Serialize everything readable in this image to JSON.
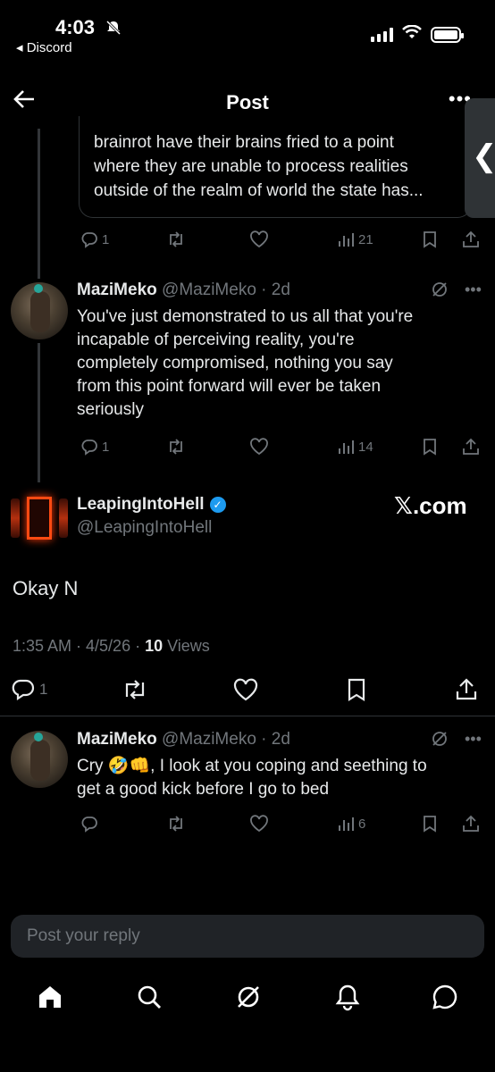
{
  "status": {
    "time": "4:03",
    "back_app": "Discord",
    "colors": {
      "text": "#ffffff"
    }
  },
  "header": {
    "title": "Post",
    "back_icon": "arrow-left-icon",
    "more_icon": "more-horizontal-icon"
  },
  "quoted_reply": {
    "text_lines": [
      "brainrot have their brains fried to a point",
      "where they are unable to process realities",
      "outside of the realm of world the state has..."
    ],
    "replies": "1",
    "views": "21"
  },
  "reply1": {
    "name": "MaziMeko",
    "handle": "@MaziMeko · 2d",
    "text_lines": [
      "You've just demonstrated to us all that you're",
      "incapable of perceiving reality, you're",
      "completely compromised, nothing you say",
      "from this point forward will ever be taken",
      "seriously"
    ],
    "replies": "1",
    "views": "14"
  },
  "main_post": {
    "name": "LeapingIntoHell",
    "handle": "@LeapingIntoHell",
    "watermark": "𝕏.com",
    "text": "Okay N",
    "time": "1:35 AM · 4/5/26 · ",
    "views_count": "10",
    "views_label": " Views",
    "replies": "1"
  },
  "reply2": {
    "name": "MaziMeko",
    "handle": "@MaziMeko · 2d",
    "text_lines": [
      "Cry 🤣👊, I look at you coping and seething to",
      "get a good kick before I go to bed"
    ],
    "views": "6"
  },
  "composer": {
    "placeholder": "Post your reply"
  },
  "tabs": [
    "home-icon",
    "search-icon",
    "grok-icon",
    "notifications-icon",
    "messages-icon"
  ],
  "colors": {
    "background": "#000000",
    "text": "#e7e9ea",
    "muted": "#71767b",
    "border": "#2f3336",
    "verified": "#1d9bf0"
  }
}
